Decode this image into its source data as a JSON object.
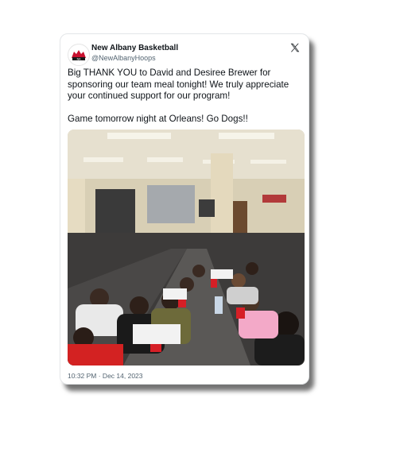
{
  "tweet": {
    "author_name": "New Albany Basketball",
    "author_handle": "@NewAlbanyHoops",
    "text_para1": "Big THANK YOU to David and Desiree Brewer for sponsoring our team meal tonight! We truly appreciate your continued support for our program!",
    "text_para2": "Game tomorrow night at Orleans! Go Dogs!!",
    "timestamp": "10:32 PM · Dec 14, 2023",
    "avatar_icon": "team-logo-icon",
    "platform_icon": "x-logo-icon"
  },
  "colors": {
    "text": "#0f1419",
    "secondary_text": "#536471",
    "logo_red": "#c8102e"
  }
}
